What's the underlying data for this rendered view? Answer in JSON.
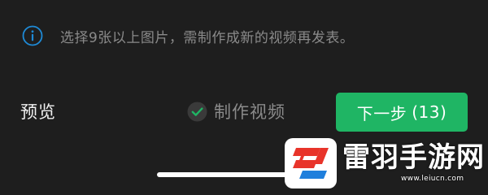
{
  "info": {
    "icon": "info-icon",
    "text": "选择9张以上图片，需制作成新的视频再发表。"
  },
  "actions": {
    "preview_label": "预览",
    "make_video_label": "制作视频",
    "make_video_checked": true,
    "next_label": "下一步",
    "next_count": "(13)"
  },
  "watermark": {
    "title": "雷羽手游网",
    "subtitle": "www.leiucn.com"
  },
  "colors": {
    "background": "#1e1e1e",
    "accent_green": "#1fb564",
    "info_blue": "#1e8ad6",
    "muted_text": "#8a8a8a",
    "logo_red": "#e8342a",
    "logo_blue": "#1f7fdc"
  }
}
